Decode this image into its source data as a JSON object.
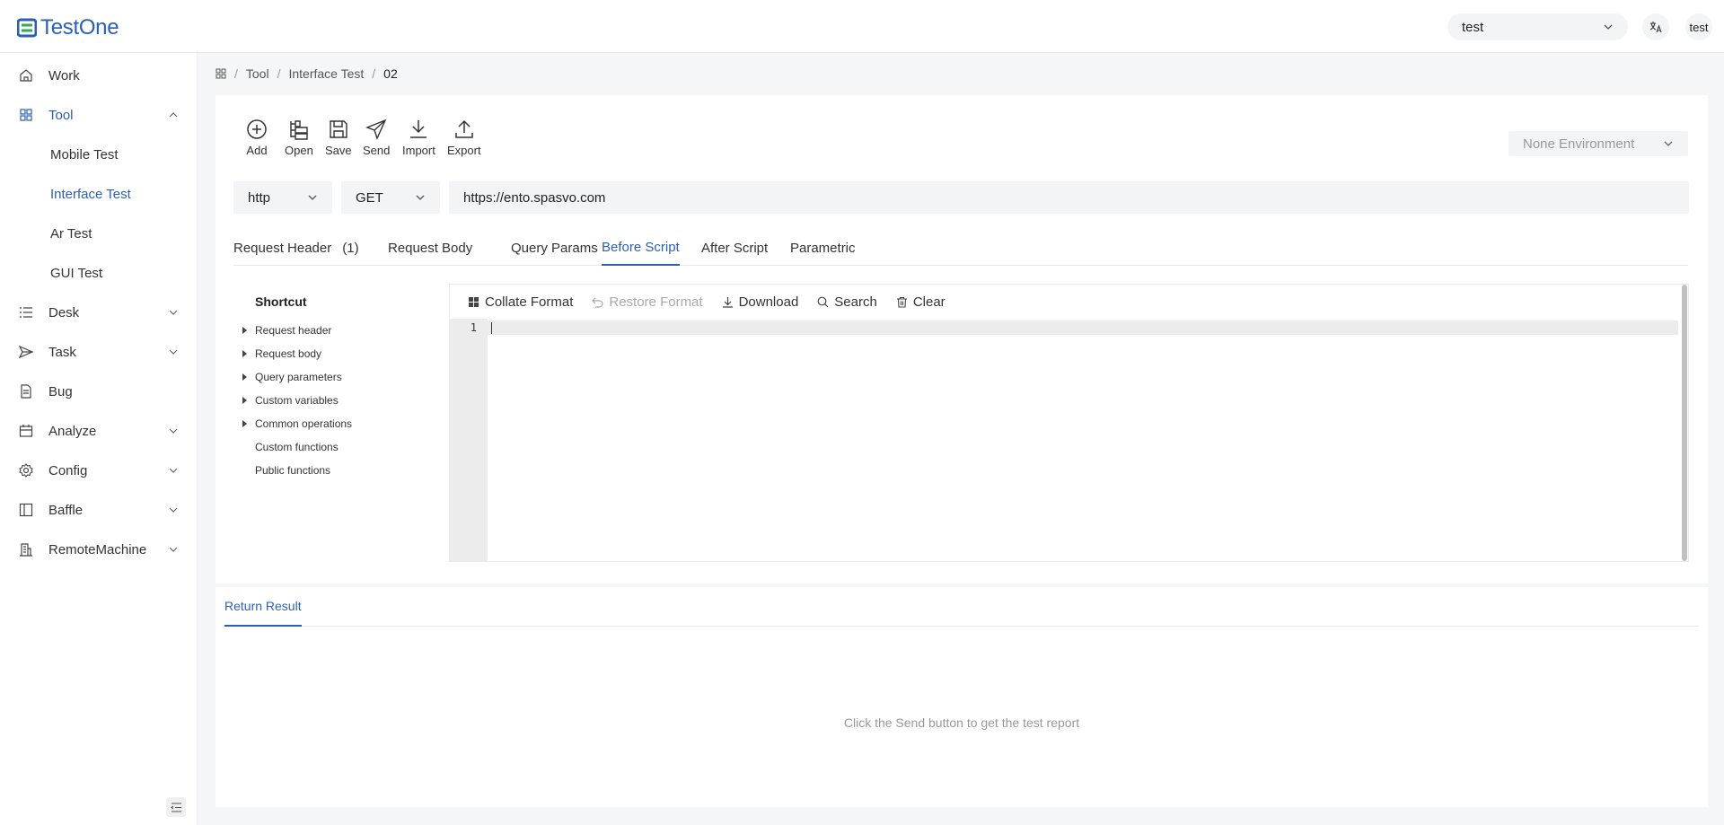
{
  "header": {
    "logo_text": "TestOne",
    "project_select": "test",
    "user_label": "test"
  },
  "sidebar": {
    "items": [
      {
        "label": "Work",
        "icon": "home-icon"
      },
      {
        "label": "Tool",
        "icon": "grid-icon"
      },
      {
        "label": "Desk",
        "icon": "list-icon"
      },
      {
        "label": "Task",
        "icon": "send-icon"
      },
      {
        "label": "Bug",
        "icon": "file-icon"
      },
      {
        "label": "Analyze",
        "icon": "calendar-icon"
      },
      {
        "label": "Config",
        "icon": "gear-icon"
      },
      {
        "label": "Baffle",
        "icon": "layout-icon"
      },
      {
        "label": "RemoteMachine",
        "icon": "building-icon"
      }
    ],
    "tool_children": [
      "Mobile Test",
      "Interface Test",
      "Ar Test",
      "GUI Test"
    ]
  },
  "breadcrumb": {
    "items": [
      "Tool",
      "Interface Test",
      "02"
    ]
  },
  "toolbar": {
    "add": "Add",
    "open": "Open",
    "save": "Save",
    "send": "Send",
    "import": "Import",
    "export": "Export"
  },
  "environment": {
    "selected": "None Environment"
  },
  "request": {
    "protocol": "http",
    "method": "GET",
    "url": "https://ento.spasvo.com"
  },
  "tabs": {
    "request_header": "Request Header",
    "request_header_count": "(1)",
    "request_body": "Request Body",
    "query_params": "Query Params",
    "before_script": "Before Script",
    "after_script": "After Script",
    "parametric": "Parametric"
  },
  "shortcut": {
    "title": "Shortcut",
    "items": [
      "Request header",
      "Request body",
      "Query parameters",
      "Custom variables",
      "Common operations",
      "Custom functions",
      "Public functions"
    ]
  },
  "editor": {
    "collate": "Collate Format",
    "restore": "Restore Format",
    "download": "Download",
    "search": "Search",
    "clear": "Clear",
    "line_number": "1"
  },
  "result": {
    "tab": "Return Result",
    "empty": "Click the Send button to get the test report"
  },
  "colors": {
    "accent": "#2a5fb8",
    "background": "#f5f6f8"
  }
}
